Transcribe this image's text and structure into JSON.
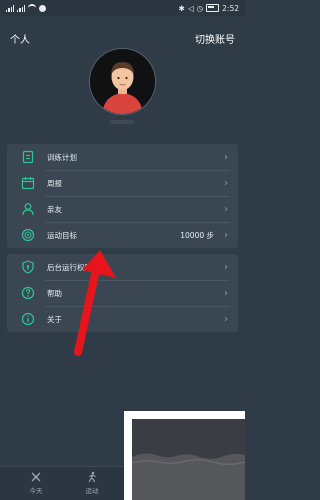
{
  "status_bar": {
    "time": "2:52",
    "icons": [
      "signal-icon",
      "signal-icon",
      "wifi-icon",
      "app-icon",
      "bluetooth-icon",
      "mute-icon",
      "alarm-icon",
      "battery-icon"
    ]
  },
  "header": {
    "title": "个人",
    "switch_account": "切换账号"
  },
  "menu_group_1": [
    {
      "label": "训练计划",
      "icon": "clipboard-icon"
    },
    {
      "label": "周报",
      "icon": "calendar-icon"
    },
    {
      "label": "亲友",
      "icon": "person-icon"
    },
    {
      "label": "运动目标",
      "icon": "target-icon",
      "value": "10000 步"
    }
  ],
  "menu_group_2": [
    {
      "label": "后台运行权限设置",
      "icon": "shield-icon"
    },
    {
      "label": "帮助",
      "icon": "help-icon"
    },
    {
      "label": "关于",
      "icon": "info-icon"
    }
  ],
  "tab_bar": {
    "today": "今天",
    "sport": "运动"
  },
  "colors": {
    "accent": "#2fc497",
    "background": "#2f3c47",
    "card": "#3a4752",
    "annotation_arrow": "#e8141b"
  }
}
